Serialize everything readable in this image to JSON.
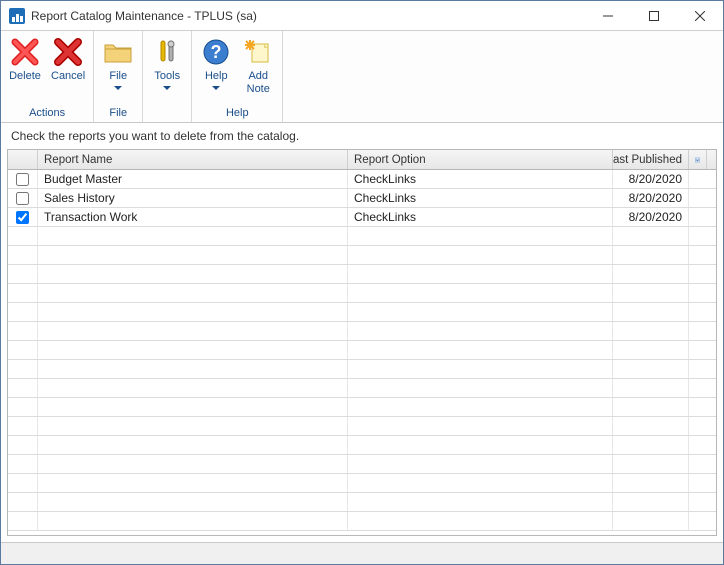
{
  "window": {
    "title": "Report Catalog Maintenance  -  TPLUS (sa)"
  },
  "ribbon": {
    "groups": [
      {
        "label": "Actions",
        "buttons": [
          {
            "id": "delete",
            "label": "Delete"
          },
          {
            "id": "cancel",
            "label": "Cancel"
          }
        ]
      },
      {
        "label": "File",
        "buttons": [
          {
            "id": "file",
            "label": "File",
            "dropdown": true
          }
        ]
      },
      {
        "label": "",
        "buttons": [
          {
            "id": "tools",
            "label": "Tools",
            "dropdown": true
          }
        ]
      },
      {
        "label": "Help",
        "buttons": [
          {
            "id": "help",
            "label": "Help",
            "dropdown": true
          },
          {
            "id": "addnote",
            "label": "Add\nNote"
          }
        ]
      }
    ]
  },
  "instruction": "Check the reports you want to delete from the catalog.",
  "grid": {
    "columns": {
      "name": "Report Name",
      "option": "Report Option",
      "last_published": "Last Published"
    },
    "rows": [
      {
        "checked": false,
        "name": "Budget Master",
        "option": "CheckLinks",
        "last_published": "8/20/2020"
      },
      {
        "checked": false,
        "name": "Sales History",
        "option": "CheckLinks",
        "last_published": "8/20/2020"
      },
      {
        "checked": true,
        "name": "Transaction Work",
        "option": "CheckLinks",
        "last_published": "8/20/2020"
      }
    ],
    "empty_visible_rows": 16
  }
}
